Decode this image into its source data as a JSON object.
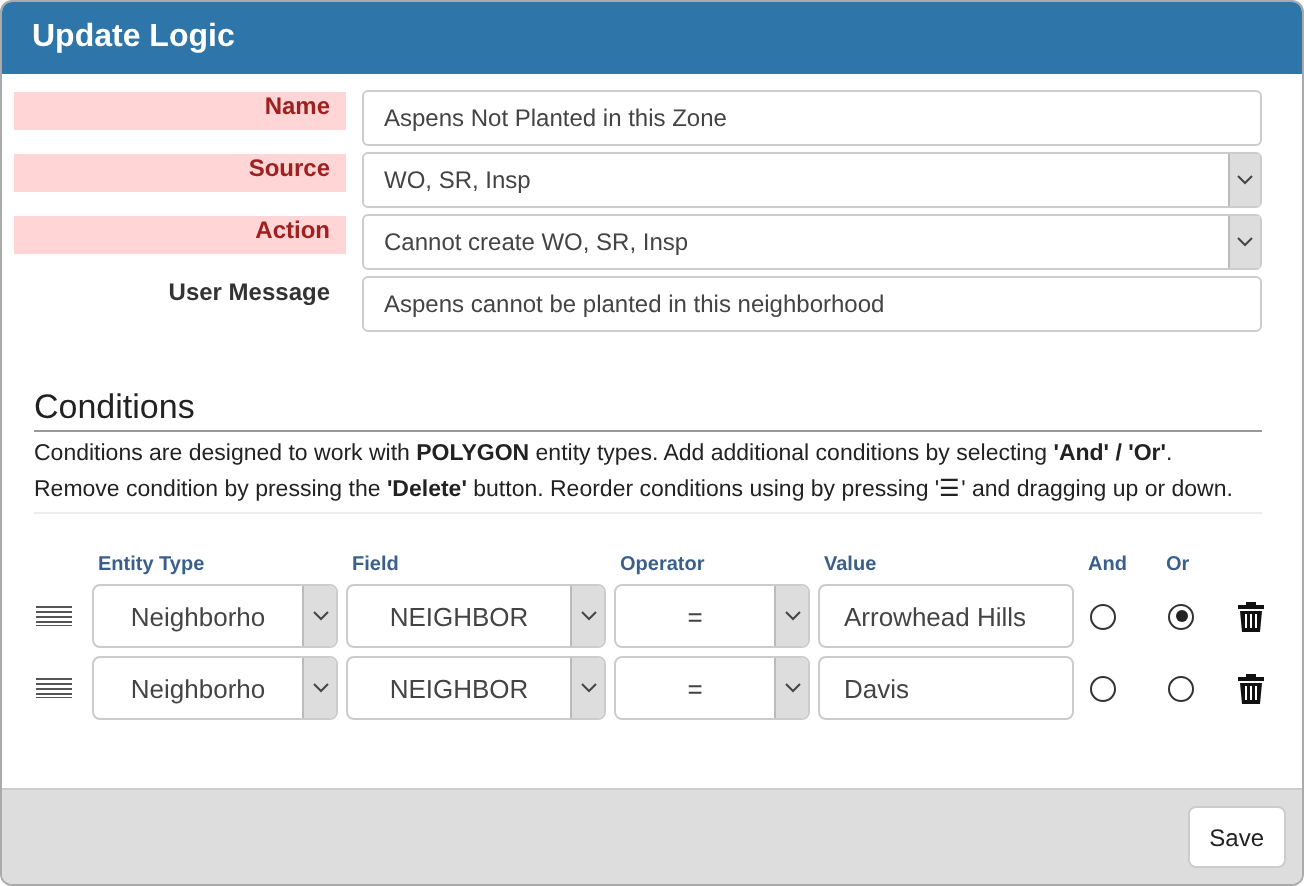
{
  "dialog": {
    "title": "Update Logic"
  },
  "fields": [
    {
      "label": "Name",
      "required": true,
      "kind": "text",
      "value": "Aspens Not Planted in this Zone"
    },
    {
      "label": "Source",
      "required": true,
      "kind": "select",
      "value": "WO, SR, Insp"
    },
    {
      "label": "Action",
      "required": true,
      "kind": "select",
      "value": "Cannot create WO, SR, Insp"
    },
    {
      "label": "User Message",
      "required": false,
      "kind": "text",
      "value": "Aspens cannot be planted in this neighborhood"
    }
  ],
  "conditions": {
    "heading": "Conditions",
    "description": "Conditions are designed to work with **POLYGON** entity types. Add additional conditions by selecting **'And' / 'Or'**. Remove condition by pressing the **'Delete'** button. Reorder conditions using by pressing '☰' and dragging up or down.",
    "columns": [
      "Entity Type",
      "Field",
      "Operator",
      "Value",
      "And",
      "Or"
    ],
    "rows": [
      {
        "entity_type": "Neighborho",
        "field": "NEIGHBOR",
        "operator": "=",
        "value": "Arrowhead Hills",
        "and": false,
        "or": true
      },
      {
        "entity_type": "Neighborho",
        "field": "NEIGHBOR",
        "operator": "=",
        "value": "Davis",
        "and": false,
        "or": false
      }
    ]
  },
  "buttons": [
    "Save"
  ]
}
